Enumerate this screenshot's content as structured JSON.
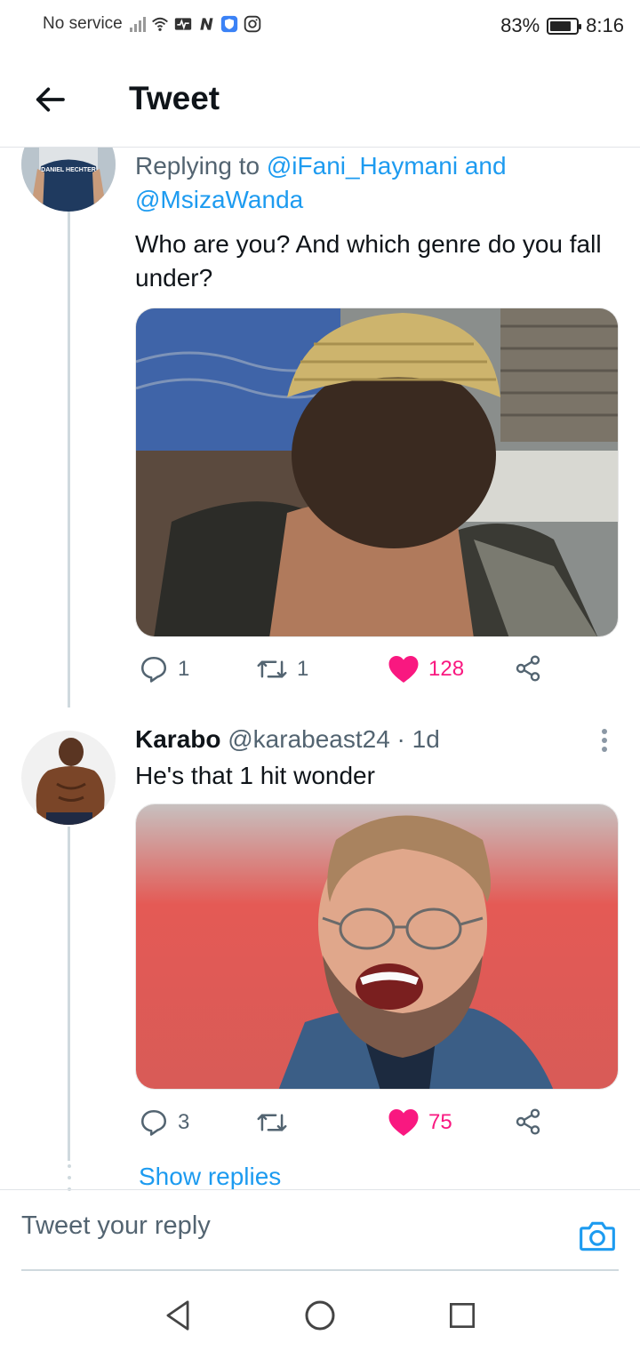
{
  "status_bar": {
    "carrier": "No service",
    "battery": "83%",
    "battery_level": 0.83,
    "time": "8:16"
  },
  "header": {
    "title": "Tweet"
  },
  "tweet1": {
    "replying_prefix": "Replying to ",
    "mention1": "@iFani_Haymani",
    "and": " and",
    "mention2": "@MsizaWanda",
    "text": "Who are you? And which genre do you fall under?",
    "avatar_shirt_text": "DANIEL HECHTER",
    "replies": "1",
    "retweets": "1",
    "likes": "128"
  },
  "tweet2": {
    "name": "Karabo",
    "meta": " @karabeast24 · 1d",
    "text": "He's that 1 hit wonder",
    "replies": "3",
    "likes": "75"
  },
  "show_replies": "Show replies",
  "reply_bar": {
    "placeholder": "Tweet your reply"
  },
  "colors": {
    "accent": "#1d9bf0",
    "like": "#f91880",
    "muted": "#536471"
  }
}
